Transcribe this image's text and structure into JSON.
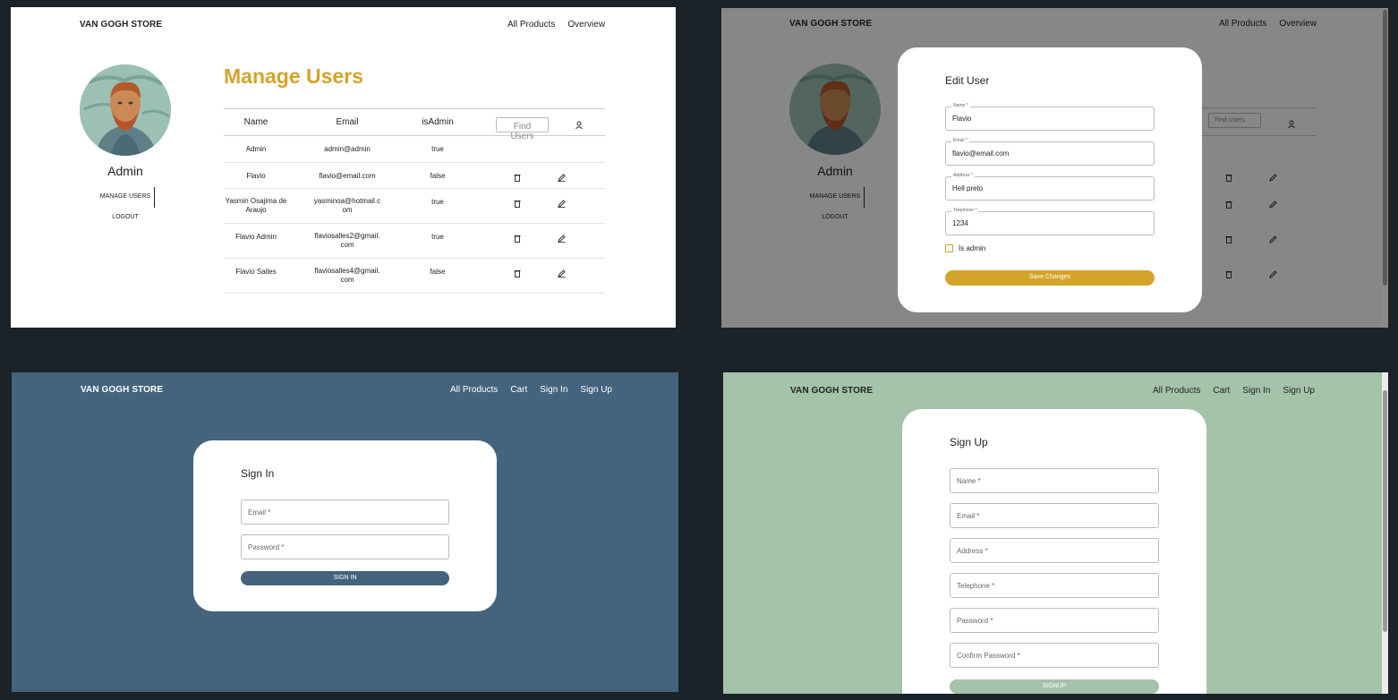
{
  "brand": "VAN GOGH STORE",
  "admin_nav": [
    "All Products",
    "Overview"
  ],
  "guest_nav": [
    "All Products",
    "Cart",
    "Sign In",
    "Sign Up"
  ],
  "sidebar": {
    "name": "Admin",
    "links": [
      "MANAGE USERS",
      "LOGOUT"
    ]
  },
  "manage_users": {
    "title": "Manage Users",
    "columns": [
      "Name",
      "Email",
      "isAdmin"
    ],
    "search_placeholder": "Find Users",
    "rows": [
      {
        "name": "Admin",
        "email": "admin@admin",
        "is_admin": "true"
      },
      {
        "name": "Flavio",
        "email": "flavio@email.com",
        "is_admin": "false"
      },
      {
        "name": "Yasmin Osajima de Araujo",
        "email": "yasminoa@hotmail.com",
        "is_admin": "true"
      },
      {
        "name": "Flavio Admin",
        "email": "flaviosalles2@gmail.com",
        "is_admin": "true"
      },
      {
        "name": "Flavio Salles",
        "email": "flaviosalles4@gmail.com",
        "is_admin": "false"
      }
    ]
  },
  "edit_user": {
    "title": "Edit User",
    "fields": [
      {
        "label": "Name *",
        "value": "Flavio"
      },
      {
        "label": "Email *",
        "value": "flavio@email.com"
      },
      {
        "label": "Address *",
        "value": "Hell preto"
      },
      {
        "label": "Telephone *",
        "value": "1234"
      }
    ],
    "is_admin_label": "Is admin",
    "save_label": "Save Changes"
  },
  "sign_in": {
    "title": "Sign In",
    "fields": [
      "Email *",
      "Password *"
    ],
    "button": "SIGN IN"
  },
  "sign_up": {
    "title": "Sign Up",
    "fields": [
      "Name *",
      "Email *",
      "Address *",
      "Telephone *",
      "Password *",
      "Confirm Password *"
    ],
    "button": "SIGNUP"
  },
  "colors": {
    "accent_gold": "#d4a42a",
    "signin_bg": "#44637d",
    "signup_bg": "#a4c3aa",
    "page_bg": "#1b2228"
  }
}
